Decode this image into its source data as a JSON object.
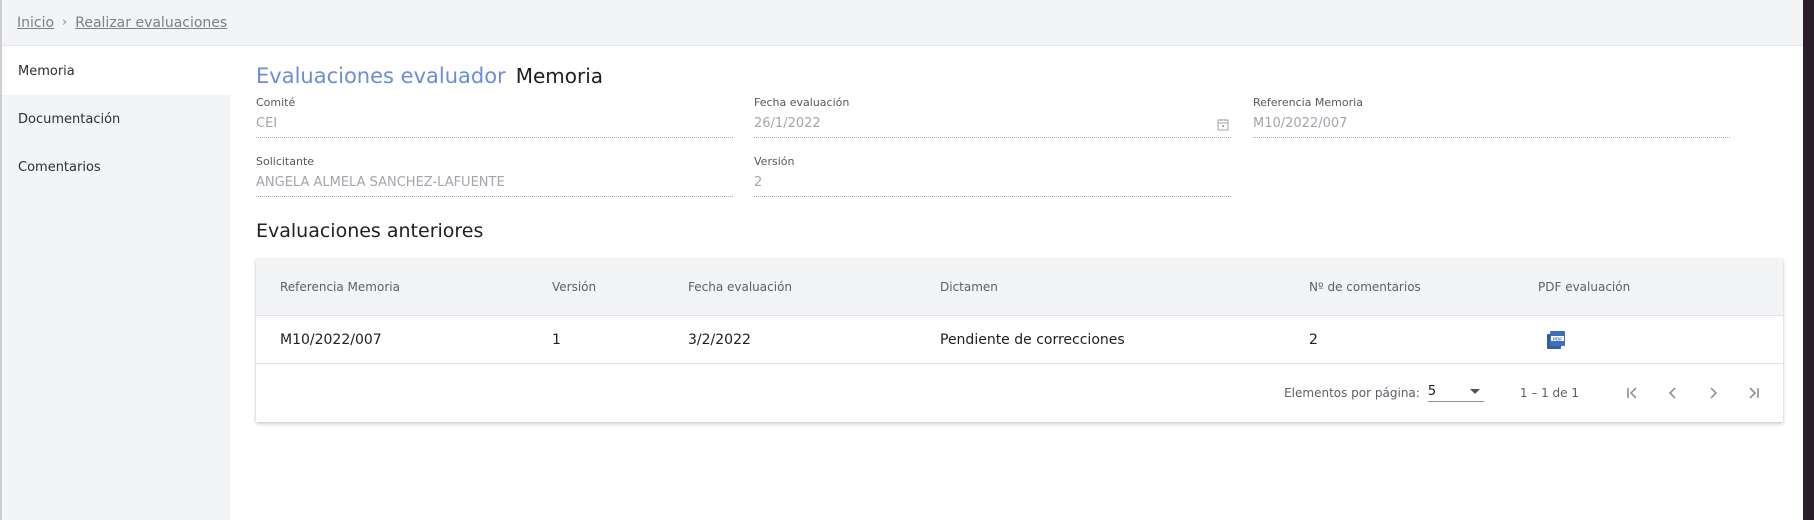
{
  "breadcrumb": {
    "home": "Inicio",
    "separator": "›",
    "current": "Realizar evaluaciones"
  },
  "sidebar": {
    "items": [
      {
        "label": "Memoria",
        "active": true
      },
      {
        "label": "Documentación",
        "active": false
      },
      {
        "label": "Comentarios",
        "active": false
      }
    ]
  },
  "header": {
    "title": "Evaluaciones evaluador",
    "subtitle": "Memoria"
  },
  "form": {
    "comite": {
      "label": "Comité",
      "value": "CEI"
    },
    "fecha": {
      "label": "Fecha evaluación",
      "value": "26/1/2022"
    },
    "referencia": {
      "label": "Referencia Memoria",
      "value": "M10/2022/007"
    },
    "solicitante": {
      "label": "Solicitante",
      "value": "ANGELA ALMELA SANCHEZ-LAFUENTE"
    },
    "version": {
      "label": "Versión",
      "value": "2"
    }
  },
  "previous": {
    "title": "Evaluaciones anteriores",
    "columns": [
      "Referencia Memoria",
      "Versión",
      "Fecha evaluación",
      "Dictamen",
      "Nº de comentarios",
      "PDF evaluación"
    ],
    "rows": [
      {
        "referencia": "M10/2022/007",
        "version": "1",
        "fecha": "3/2/2022",
        "dictamen": "Pendiente de correcciones",
        "comentarios": "2",
        "pdf_icon": "pdf-icon"
      }
    ]
  },
  "paginator": {
    "items_label": "Elementos por página:",
    "page_size": "5",
    "range": "1 – 1 de 1"
  },
  "colors": {
    "accent": "#6b8ed6",
    "pdf": "#3f6fb8",
    "sidebar_bg": "#f2f4f6"
  }
}
